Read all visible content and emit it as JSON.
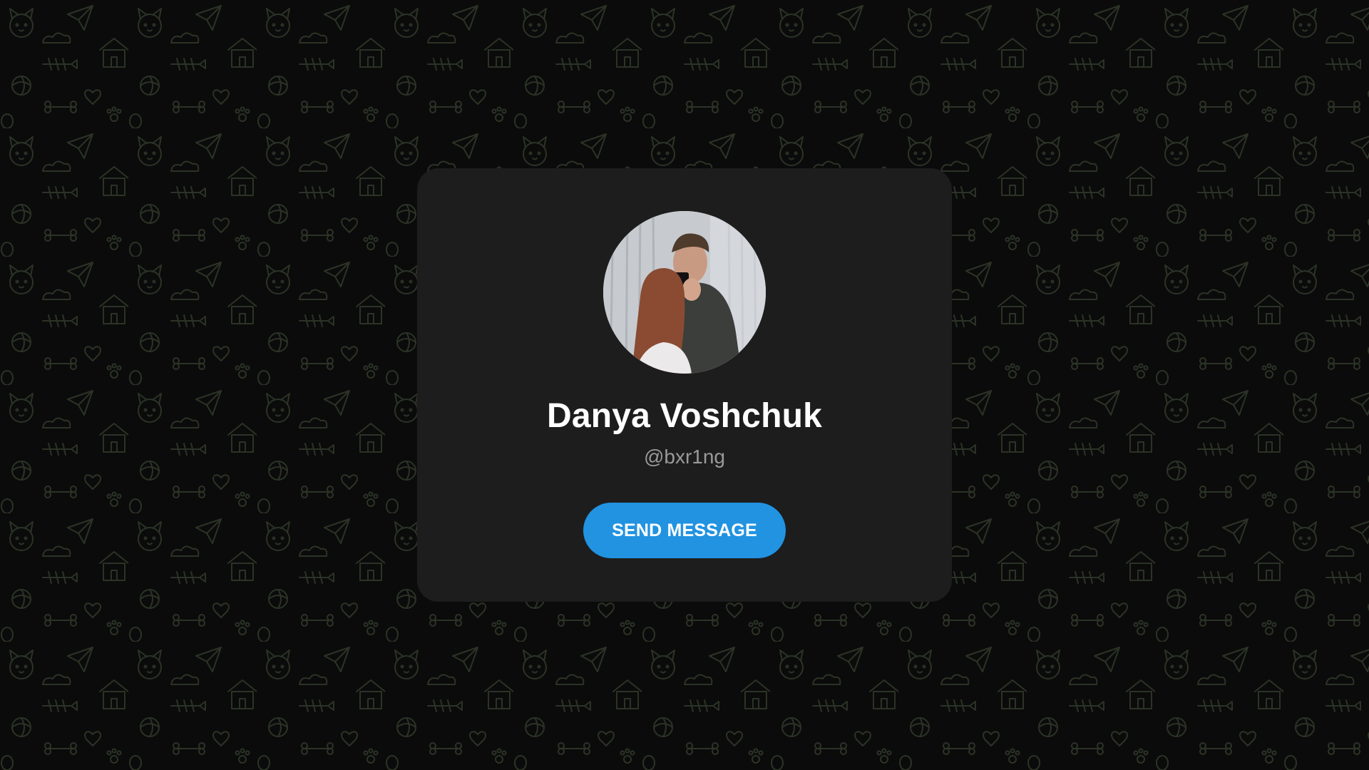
{
  "profile": {
    "name": "Danya Voshchuk",
    "username": "@bxr1ng",
    "avatar_icon": "profile-photo"
  },
  "actions": {
    "send_label": "SEND MESSAGE"
  },
  "colors": {
    "background": "#0b0b0b",
    "pattern": "#2b3326",
    "card": "#1d1d1d",
    "accent": "#2193e1",
    "name_text": "#ffffff",
    "username_text": "#9a9a9a"
  }
}
